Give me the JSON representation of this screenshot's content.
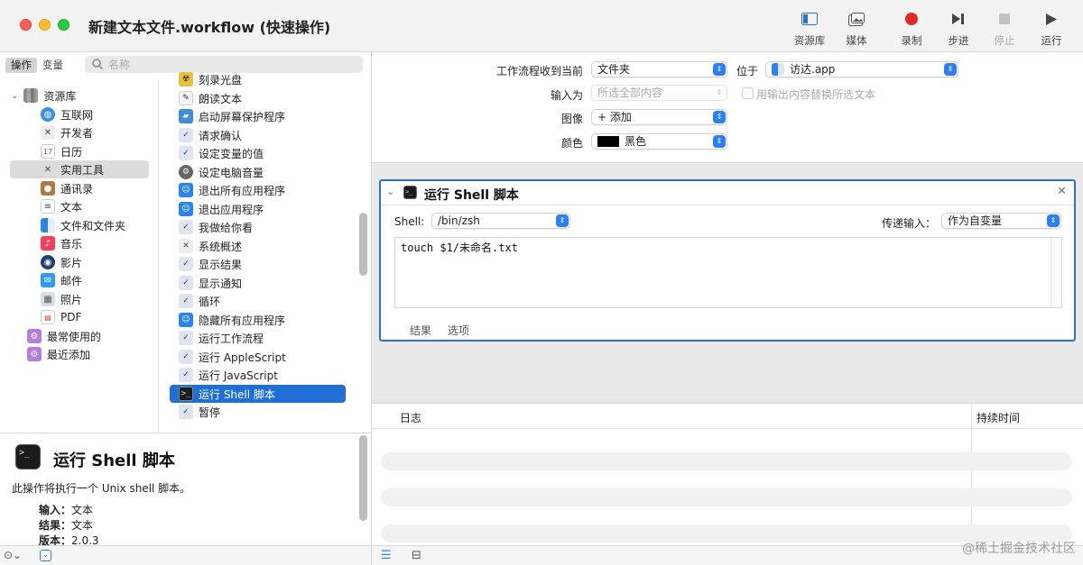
{
  "window": {
    "title": "新建文本文件.workflow (快速操作)"
  },
  "toolbar": {
    "library": "资源库",
    "media": "媒体",
    "record": "录制",
    "step": "步进",
    "stop": "停止",
    "run": "运行"
  },
  "left_tabs": {
    "actions": "操作",
    "variables": "变量"
  },
  "search": {
    "placeholder": "名称"
  },
  "sidebar": {
    "root": "资源库",
    "items": [
      "互联网",
      "开发者",
      "日历",
      "实用工具",
      "通讯录",
      "文本",
      "文件和文件夹",
      "音乐",
      "影片",
      "邮件",
      "照片",
      "PDF"
    ],
    "calendar_day": "17",
    "selected": "实用工具",
    "extra": [
      "最常使用的",
      "最近添加"
    ]
  },
  "actions": {
    "items": [
      "刻录光盘",
      "朗读文本",
      "启动屏幕保护程序",
      "请求确认",
      "设定变量的值",
      "设定电脑音量",
      "退出所有应用程序",
      "退出应用程序",
      "我做给你看",
      "系统概述",
      "显示结果",
      "显示通知",
      "循环",
      "隐藏所有应用程序",
      "运行工作流程",
      "运行 AppleScript",
      "运行 JavaScript",
      "运行 Shell 脚本",
      "暂停"
    ],
    "selected": "运行 Shell 脚本"
  },
  "description": {
    "title": "运行 Shell 脚本",
    "text": "此操作将执行一个 Unix shell 脚本。",
    "input_label": "输入：",
    "input_value": "文本",
    "result_label": "结果：",
    "result_value": "文本",
    "version_label": "版本：",
    "version_value": "2.0.3"
  },
  "workflow_props": {
    "receives_label": "工作流程收到当前",
    "receives_value": "文件夹",
    "in_label": "位于",
    "in_value": "访达.app",
    "input_is_label": "输入为",
    "input_is_value": "所选全部内容",
    "replace_label": "用输出内容替换所选文本",
    "image_label": "图像",
    "image_value": "+ 添加",
    "color_label": "颜色",
    "color_value": "黑色",
    "color_swatch": "#000000"
  },
  "shell_action": {
    "title": "运行 Shell 脚本",
    "shell_label": "Shell:",
    "shell_value": "/bin/zsh",
    "pass_label": "传递输入：",
    "pass_value": "作为自变量",
    "script": "touch $1/未命名.txt",
    "tab_results": "结果",
    "tab_options": "选项"
  },
  "log": {
    "col_log": "日志",
    "col_duration": "持续时间"
  },
  "watermark": "@稀土掘金技术社区",
  "colors": {
    "accent": "#2b72d6",
    "record": "#e02a2a",
    "selection": "#1f6fd6"
  }
}
